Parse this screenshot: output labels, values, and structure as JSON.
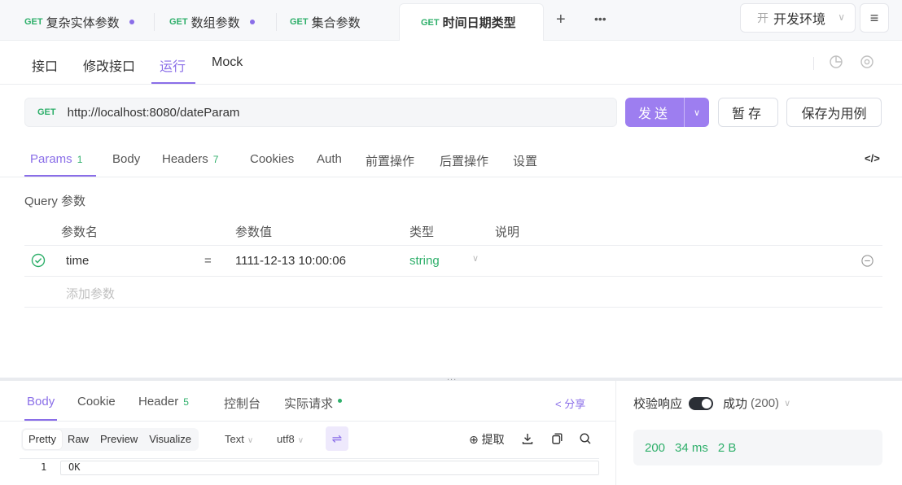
{
  "tabs": [
    {
      "method": "GET",
      "label": "复杂实体参数",
      "modified": true
    },
    {
      "method": "GET",
      "label": "数组参数",
      "modified": true
    },
    {
      "method": "GET",
      "label": "集合参数",
      "modified": false
    },
    {
      "method": "GET",
      "label": "时间日期类型",
      "active": true
    }
  ],
  "env": {
    "badge": "开",
    "label": "开发环境"
  },
  "icons": {
    "add": "plus-icon",
    "more": "ellipsis-icon",
    "menu": "hamburger-icon"
  },
  "subnav": {
    "items": [
      "接口",
      "修改接口",
      "运行",
      "Mock"
    ],
    "active": "运行"
  },
  "request": {
    "method": "GET",
    "url": "http://localhost:8080/dateParam",
    "send_label": "发送",
    "save_label": "暂存",
    "save_case_label": "保存为用例"
  },
  "req_tabs": [
    {
      "label": "Params",
      "badge": "1",
      "active": true
    },
    {
      "label": "Body"
    },
    {
      "label": "Headers",
      "badge": "7"
    },
    {
      "label": "Cookies"
    },
    {
      "label": "Auth"
    },
    {
      "label": "前置操作"
    },
    {
      "label": "后置操作"
    },
    {
      "label": "设置"
    }
  ],
  "code_icon": "</>",
  "query": {
    "title": "Query 参数",
    "columns": [
      "参数名",
      "参数值",
      "类型",
      "说明"
    ],
    "rows": [
      {
        "name": "time",
        "eq": "=",
        "value": "1111-12-13 10:00:06",
        "type": "string",
        "enabled": true
      }
    ],
    "add_placeholder": "添加参数"
  },
  "grip": "...",
  "response": {
    "tabs": [
      {
        "label": "Body",
        "active": true
      },
      {
        "label": "Cookie"
      },
      {
        "label": "Header",
        "badge": "5"
      },
      {
        "label": "控制台"
      },
      {
        "label": "实际请求",
        "dot": true
      }
    ],
    "share_label": "分享",
    "formats": [
      "Pretty",
      "Raw",
      "Preview",
      "Visualize"
    ],
    "active_format": "Pretty",
    "lang": "Text",
    "encoding": "utf8",
    "extract_label": "提取",
    "body_lines": [
      {
        "no": "1",
        "text": "OK"
      }
    ]
  },
  "validation": {
    "label": "校验响应",
    "enabled": true,
    "result": "成功",
    "code": "(200)"
  },
  "metrics": {
    "status": "200",
    "time": "34 ms",
    "size": "2 B"
  },
  "colors": {
    "accent": "#8a6ee8",
    "get": "#2eaf6a",
    "success": "#2eaf6a"
  }
}
